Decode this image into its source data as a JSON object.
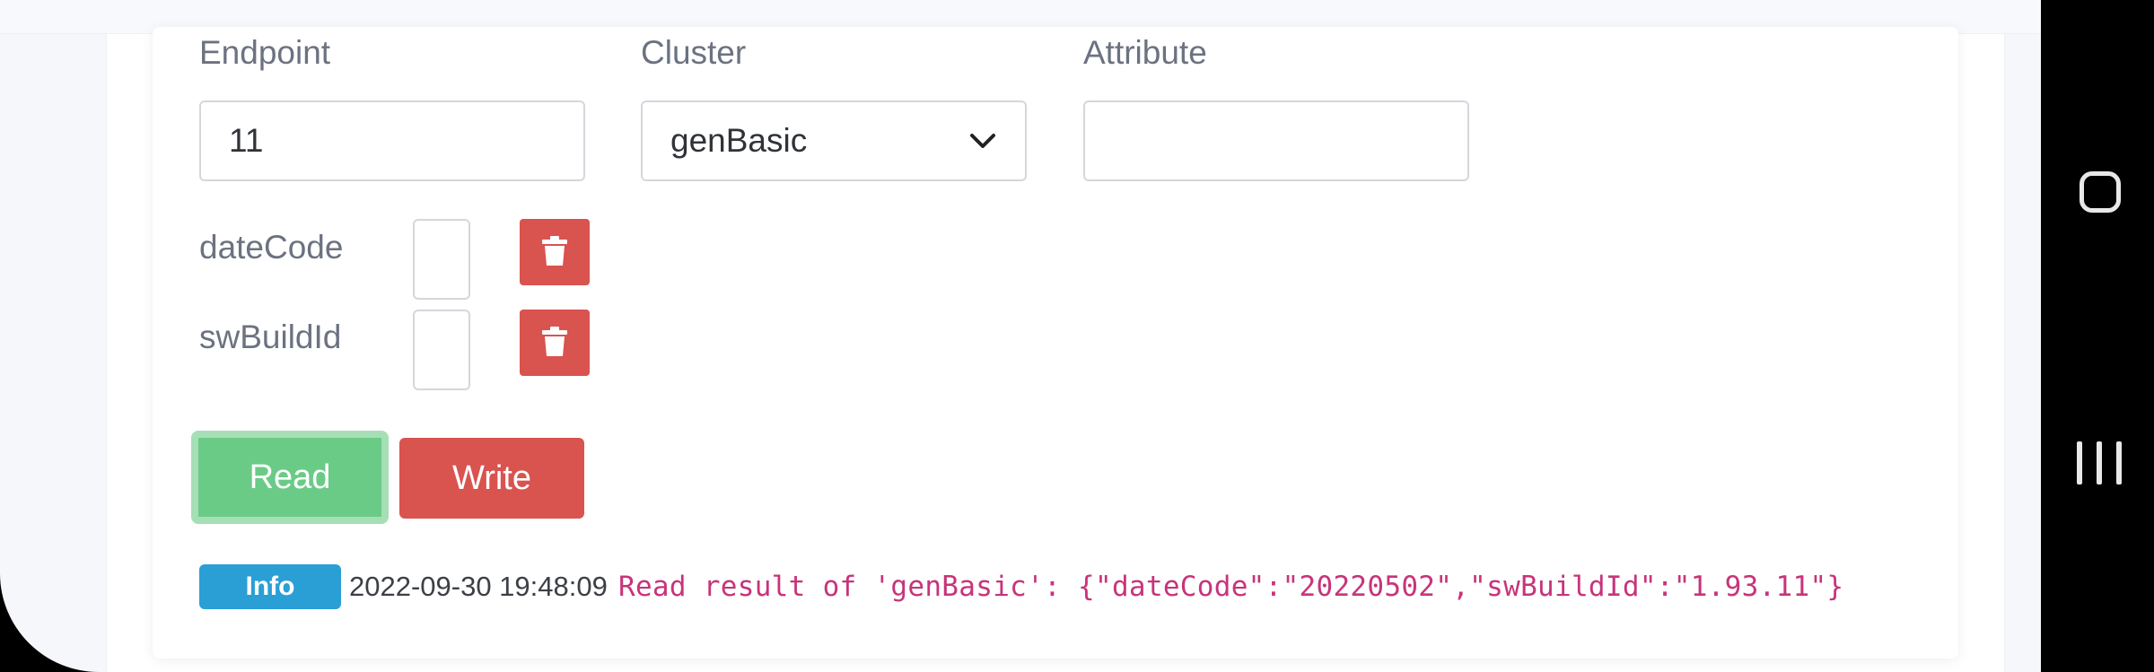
{
  "form": {
    "endpoint_label": "Endpoint",
    "endpoint_value": "11",
    "cluster_label": "Cluster",
    "cluster_value": "genBasic",
    "attribute_label": "Attribute",
    "attribute_value": ""
  },
  "attributes": [
    {
      "name": "dateCode"
    },
    {
      "name": "swBuildId"
    }
  ],
  "actions": {
    "read_label": "Read",
    "write_label": "Write"
  },
  "log": {
    "badge": "Info",
    "timestamp": "2022-09-30 19:48:09",
    "message": "Read result of 'genBasic': {\"dateCode\":\"20220502\",\"swBuildId\":\"1.93.11\"}"
  },
  "colors": {
    "read": "#6acb87",
    "danger": "#d9534f",
    "info": "#2a9fd6",
    "log_text": "#c7347a"
  },
  "icons": {
    "delete": "trash-icon",
    "dropdown": "chevron-down-icon",
    "nav_home": "home-square-icon",
    "nav_recents": "recents-icon"
  }
}
